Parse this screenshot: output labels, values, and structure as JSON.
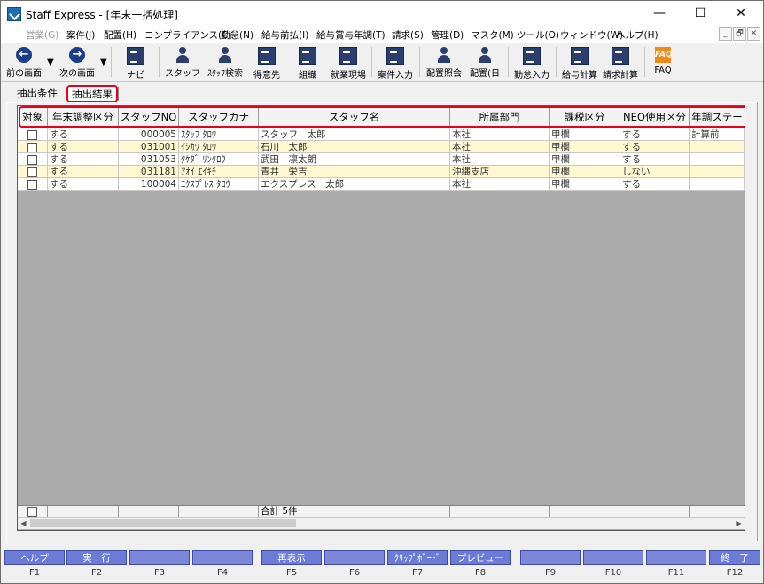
{
  "window": {
    "title": "Staff Express - [年末一括処理]",
    "controls": [
      "—",
      "☐",
      "✕"
    ]
  },
  "menu": [
    {
      "label": "営業(G)",
      "disabled": true
    },
    {
      "label": "案件(J)"
    },
    {
      "label": "配置(H)"
    },
    {
      "label": "コンプライアンス(C)"
    },
    {
      "label": "勤怠(N)"
    },
    {
      "label": "給与前払(I)"
    },
    {
      "label": "給与賞与年調(T)"
    },
    {
      "label": "請求(S)"
    },
    {
      "label": "管理(D)"
    },
    {
      "label": "マスタ(M)"
    },
    {
      "label": "ツール(O)"
    },
    {
      "label": "ウィンドウ(W)"
    },
    {
      "label": "ヘルプ(H)"
    }
  ],
  "mdi_controls": [
    "_",
    "🗗",
    "✕"
  ],
  "toolbar": [
    {
      "label": "前の画面",
      "icon": "arrow-left-icon"
    },
    {
      "label": "次の画面",
      "icon": "arrow-right-icon"
    },
    {
      "label": "ナビ",
      "icon": "navi-icon"
    },
    {
      "label": "スタッフ",
      "icon": "staff-icon"
    },
    {
      "label": "ｽﾀｯﾌ検索",
      "icon": "staff-search-icon"
    },
    {
      "label": "得意先",
      "icon": "client-icon"
    },
    {
      "label": "組織",
      "icon": "organization-icon"
    },
    {
      "label": "就業現場",
      "icon": "worksite-icon"
    },
    {
      "label": "案件入力",
      "icon": "case-entry-icon"
    },
    {
      "label": "配置照会",
      "icon": "placement-inquiry-icon"
    },
    {
      "label": "配置(日",
      "icon": "placement-daily-icon"
    },
    {
      "label": "勤怠入力",
      "icon": "attendance-entry-icon"
    },
    {
      "label": "給与計算",
      "icon": "payroll-calc-icon"
    },
    {
      "label": "請求計算",
      "icon": "billing-calc-icon"
    },
    {
      "label": "FAQ",
      "icon": "faq-icon"
    }
  ],
  "tabs": [
    {
      "label": "抽出条件",
      "active": false
    },
    {
      "label": "抽出結果",
      "active": true
    }
  ],
  "grid": {
    "columns": [
      "対象",
      "年末調整区分",
      "スタッフNO",
      "スタッフカナ",
      "スタッフ名",
      "所属部門",
      "課税区分",
      "NEO使用区分",
      "年調ステー"
    ],
    "rows": [
      {
        "adjust": "する",
        "no": "000005",
        "kana": "ｽﾀｯﾌ ﾀﾛｳ",
        "name": "スタッフ　太郎",
        "dept": "本社",
        "tax": "甲欄",
        "neo": "する",
        "status": "計算前"
      },
      {
        "adjust": "する",
        "no": "031001",
        "kana": "ｲｼｶﾜ ﾀﾛｳ",
        "name": "石川　太郎",
        "dept": "本社",
        "tax": "甲欄",
        "neo": "する",
        "status": ""
      },
      {
        "adjust": "する",
        "no": "031053",
        "kana": "ﾀｹﾀﾞ ﾘﾝﾀﾛｳ",
        "name": "武田　凛太朗",
        "dept": "本社",
        "tax": "甲欄",
        "neo": "する",
        "status": ""
      },
      {
        "adjust": "する",
        "no": "031181",
        "kana": "ｱｵｲ ｴｲｷﾁ",
        "name": "青井　栄吉",
        "dept": "沖縄支店",
        "tax": "甲欄",
        "neo": "しない",
        "status": ""
      },
      {
        "adjust": "する",
        "no": "100004",
        "kana": "ｴｸｽﾌﾟﾚｽ ﾀﾛｳ",
        "name": "エクスプレス　太郎",
        "dept": "本社",
        "tax": "甲欄",
        "neo": "する",
        "status": ""
      }
    ],
    "total": "合計 5件",
    "row_colors": [
      "#ffffff",
      "#fff8d0"
    ]
  },
  "fkeys": [
    {
      "label": "ヘルプ",
      "key": "F1"
    },
    {
      "label": "実　行",
      "key": "F2"
    },
    {
      "label": "",
      "key": "F3"
    },
    {
      "label": "",
      "key": "F4"
    },
    {
      "label": "再表示",
      "key": "F5"
    },
    {
      "label": "",
      "key": "F6"
    },
    {
      "label": "ｸﾘｯﾌﾟﾎﾞｰﾄﾞ",
      "key": "F7"
    },
    {
      "label": "プレビュー",
      "key": "F8"
    },
    {
      "label": "",
      "key": "F9"
    },
    {
      "label": "",
      "key": "F10"
    },
    {
      "label": "",
      "key": "F11"
    },
    {
      "label": "終　了",
      "key": "F12"
    }
  ]
}
